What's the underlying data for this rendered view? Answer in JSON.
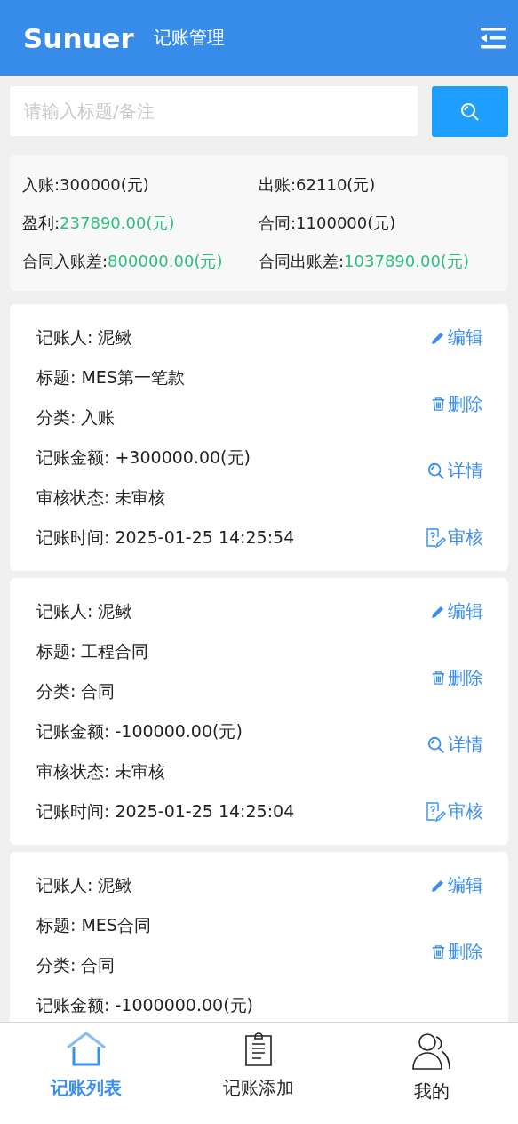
{
  "header": {
    "logo": "Sunuer",
    "title": "记账管理"
  },
  "search": {
    "placeholder": "请输入标题/备注"
  },
  "summary": [
    {
      "label": "入账:",
      "value": "300000(元)",
      "highlight": false
    },
    {
      "label": "出账:",
      "value": "62110(元)",
      "highlight": false
    },
    {
      "label": "盈利:",
      "value": "237890.00(元)",
      "highlight": true
    },
    {
      "label": "合同:",
      "value": "1100000(元)",
      "highlight": false
    },
    {
      "label": "合同入账差:",
      "value": "800000.00(元)",
      "highlight": true
    },
    {
      "label": "合同出账差:",
      "value": "1037890.00(元)",
      "highlight": true
    }
  ],
  "records": [
    {
      "fields": [
        "记账人: 泥鳅",
        "标题: MES第一笔款",
        "分类: 入账",
        "记账金额: +300000.00(元)",
        "审核状态: 未审核",
        "记账时间: 2025-01-25 14:25:54"
      ],
      "actions": [
        {
          "kind": "edit",
          "label": "编辑"
        },
        {
          "kind": "delete",
          "label": "删除"
        },
        {
          "kind": "detail",
          "label": "详情"
        },
        {
          "kind": "review",
          "label": "审核"
        }
      ]
    },
    {
      "fields": [
        "记账人: 泥鳅",
        "标题: 工程合同",
        "分类: 合同",
        "记账金额: -100000.00(元)",
        "审核状态: 未审核",
        "记账时间: 2025-01-25 14:25:04"
      ],
      "actions": [
        {
          "kind": "edit",
          "label": "编辑"
        },
        {
          "kind": "delete",
          "label": "删除"
        },
        {
          "kind": "detail",
          "label": "详情"
        },
        {
          "kind": "review",
          "label": "审核"
        }
      ]
    },
    {
      "fields": [
        "记账人: 泥鳅",
        "标题: MES合同",
        "分类: 合同",
        "记账金额: -1000000.00(元)"
      ],
      "actions": [
        {
          "kind": "edit",
          "label": "编辑"
        },
        {
          "kind": "delete",
          "label": "删除"
        }
      ]
    }
  ],
  "tabs": [
    {
      "kind": "home",
      "label": "记账列表",
      "selected": true
    },
    {
      "kind": "add",
      "label": "记账添加",
      "selected": false
    },
    {
      "kind": "me",
      "label": "我的",
      "selected": false
    }
  ]
}
